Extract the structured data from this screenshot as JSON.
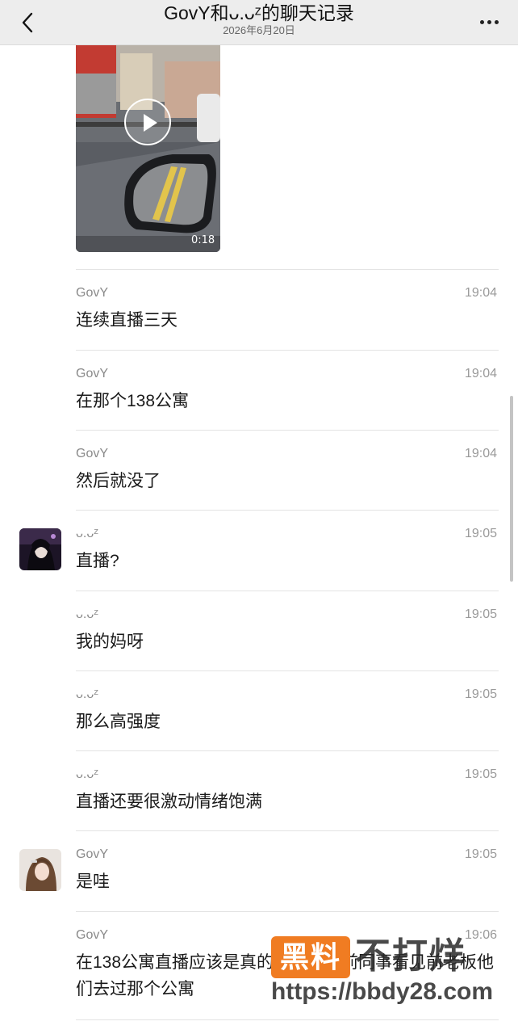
{
  "header": {
    "title": "GovY和ᴗ.ᴗᶻ的聊天记录",
    "date": "2026年6月20日",
    "back_icon": "chevron-left-icon",
    "more_icon": "more-dots-icon"
  },
  "video": {
    "duration": "0:18",
    "play_icon": "play-icon"
  },
  "messages": [
    {
      "sender": "GovY",
      "time": "19:04",
      "text": "连续直播三天",
      "avatar": ""
    },
    {
      "sender": "GovY",
      "time": "19:04",
      "text": "在那个138公寓",
      "avatar": ""
    },
    {
      "sender": "GovY",
      "time": "19:04",
      "text": "然后就没了",
      "avatar": ""
    },
    {
      "sender": "ᴗ.ᴗᶻ",
      "time": "19:05",
      "text": "直播?",
      "avatar": "avatar-dark"
    },
    {
      "sender": "ᴗ.ᴗᶻ",
      "time": "19:05",
      "text": "我的妈呀",
      "avatar": ""
    },
    {
      "sender": "ᴗ.ᴗᶻ",
      "time": "19:05",
      "text": "那么高强度",
      "avatar": ""
    },
    {
      "sender": "ᴗ.ᴗᶻ",
      "time": "19:05",
      "text": "直播还要很激动情绪饱满",
      "avatar": ""
    },
    {
      "sender": "GovY",
      "time": "19:05",
      "text": "是哇",
      "avatar": "avatar-light"
    },
    {
      "sender": "GovY",
      "time": "19:06",
      "text": "在138公寓直播应该是真的，我有以前同事看见前老板他们去过那个公寓",
      "avatar": ""
    }
  ],
  "watermark": {
    "badge": "黑料",
    "title": "不打烊",
    "url": "https://bbdy28.com"
  }
}
